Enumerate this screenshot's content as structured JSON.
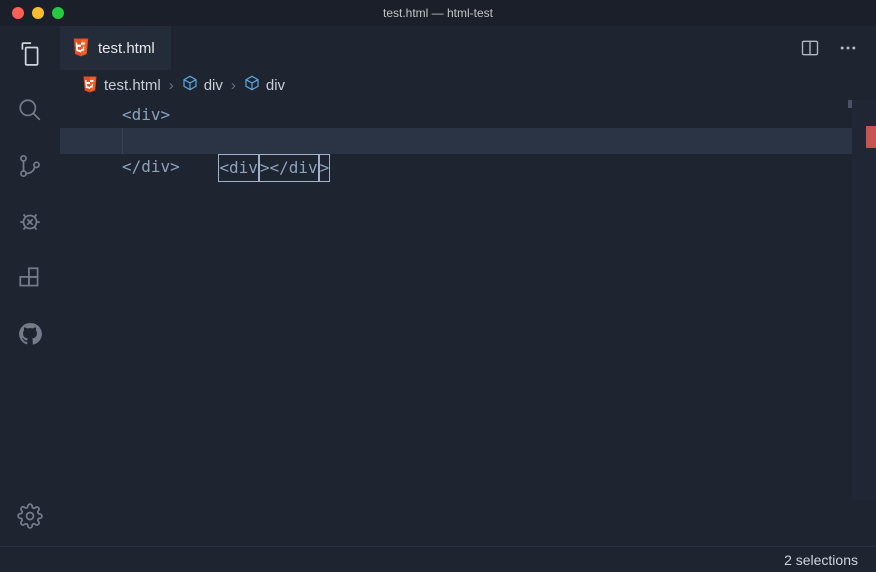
{
  "window": {
    "title": "test.html — html-test"
  },
  "tab": {
    "filename": "test.html"
  },
  "breadcrumbs": {
    "file": "test.html",
    "seg1": "div",
    "seg2": "div"
  },
  "code": {
    "line1": "<div>",
    "line2_a": "<div",
    "line2_b": "></div",
    "line2_c": ">",
    "line3": "</div>"
  },
  "status": {
    "selections": "2 selections"
  }
}
